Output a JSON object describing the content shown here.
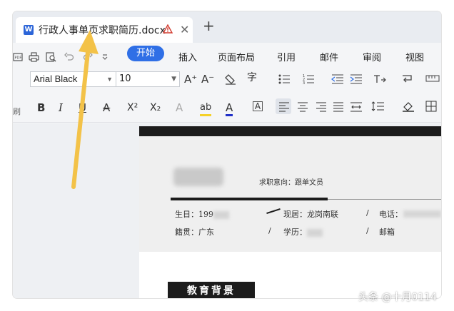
{
  "tab": {
    "app_icon": "W",
    "title": "行政人事单页求职简历.docx",
    "warning_icon": "warning-icon",
    "close_glyph": "✕",
    "new_tab_glyph": "+"
  },
  "menu": {
    "items": [
      "开始",
      "插入",
      "页面布局",
      "引用",
      "邮件",
      "审阅",
      "视图"
    ],
    "active": "开始"
  },
  "ribbon": {
    "font_name": "Arial Black",
    "font_size": "10",
    "side_label": "刷",
    "buttons": {
      "grow_font": "A⁺",
      "shrink_font": "A⁻",
      "bold": "B",
      "italic": "I",
      "underline": "U",
      "strike": "A",
      "superscript": "X²",
      "subscript": "X₂",
      "text_effect": "A",
      "highlight": "ab",
      "font_color": "A",
      "char_border": "A",
      "phonetic": "字"
    }
  },
  "document": {
    "intent": "求职意向：跟单文员",
    "birth_label": "生日：199",
    "address_label": "现居：龙岗南联",
    "phone_label": "电话：",
    "origin_label": "籍贯：广东",
    "education_label": "学历：",
    "email_label": "邮箱",
    "separator": "/",
    "section_title": "教育背景"
  },
  "watermark": "头条 @十月0114",
  "colors": {
    "accent": "#2f6fe6",
    "arrow": "#f3c248",
    "dark": "#1c1c1c"
  }
}
